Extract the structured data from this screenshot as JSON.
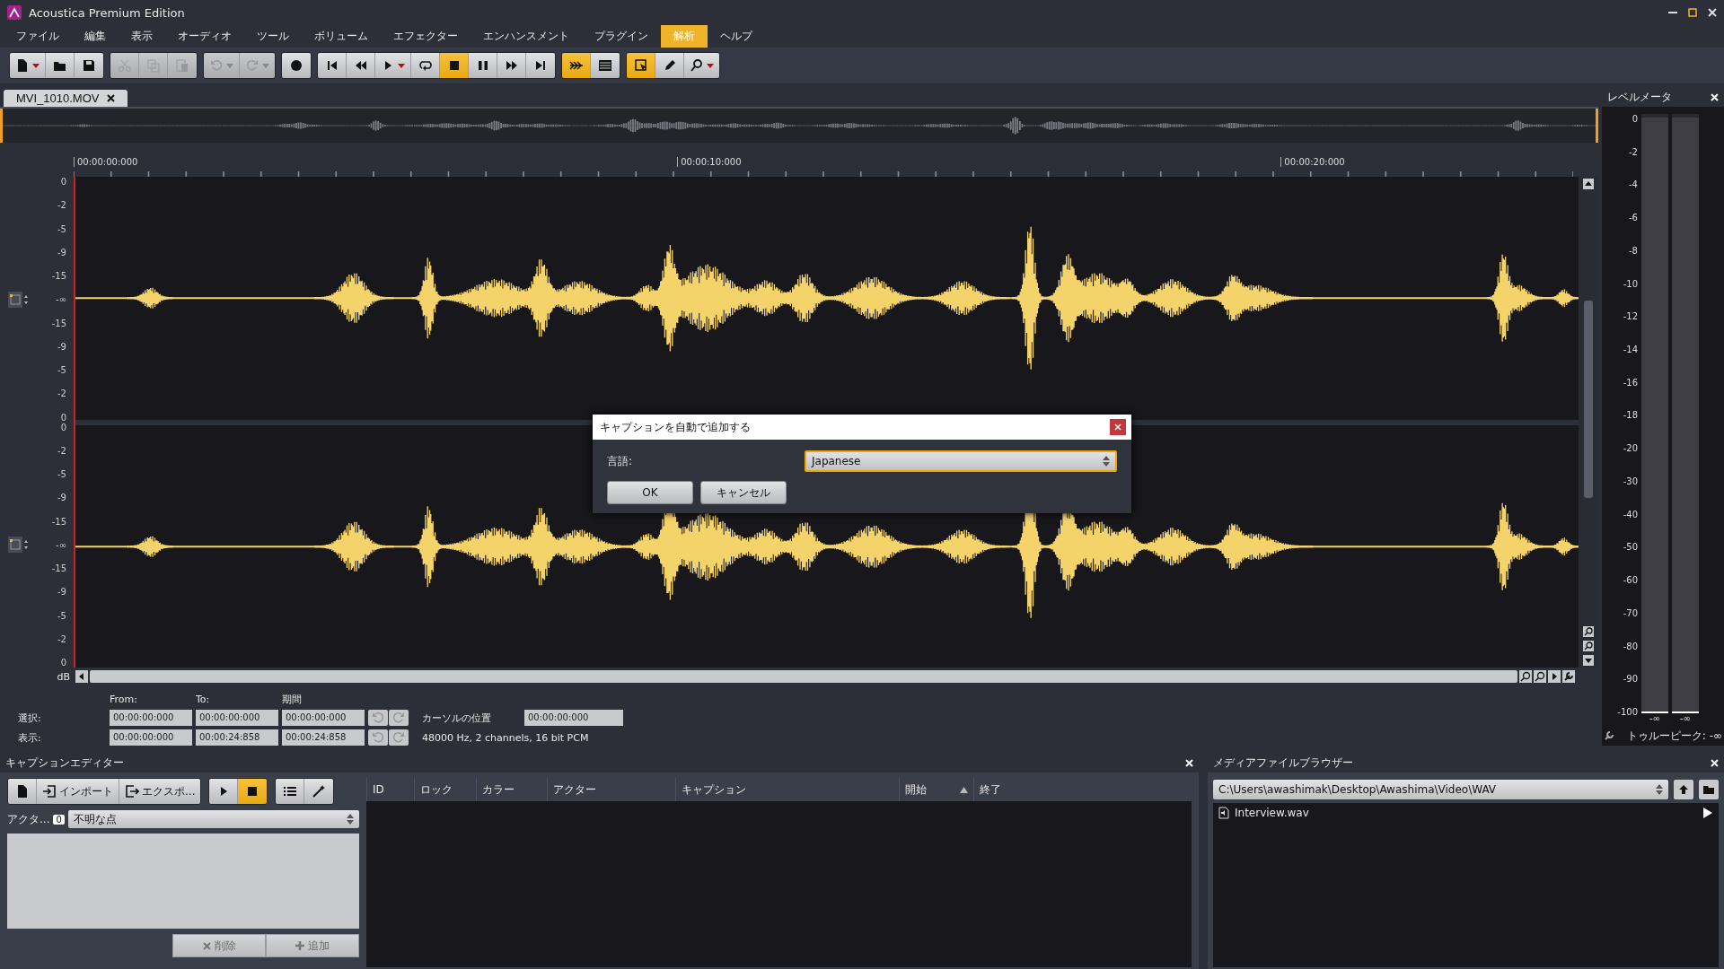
{
  "window": {
    "title": "Acoustica Premium Edition"
  },
  "menu": [
    {
      "label": "ファイル",
      "selected": false
    },
    {
      "label": "編集",
      "selected": false
    },
    {
      "label": "表示",
      "selected": false
    },
    {
      "label": "オーディオ",
      "selected": false
    },
    {
      "label": "ツール",
      "selected": false
    },
    {
      "label": "ボリューム",
      "selected": false
    },
    {
      "label": "エフェクター",
      "selected": false
    },
    {
      "label": "エンハンスメント",
      "selected": false
    },
    {
      "label": "プラグイン",
      "selected": false
    },
    {
      "label": "解析",
      "selected": true
    },
    {
      "label": "ヘルプ",
      "selected": false
    }
  ],
  "toolbar": [
    [
      {
        "kind": "new",
        "on": false,
        "disabled": false
      },
      {
        "kind": "open",
        "on": false,
        "disabled": false
      },
      {
        "kind": "save",
        "on": false,
        "disabled": false
      }
    ],
    [
      {
        "kind": "cut",
        "on": false,
        "disabled": true
      },
      {
        "kind": "copy",
        "on": false,
        "disabled": true
      },
      {
        "kind": "paste",
        "on": false,
        "disabled": true
      }
    ],
    [
      {
        "kind": "undo",
        "on": false,
        "disabled": true
      },
      {
        "kind": "redo",
        "on": false,
        "disabled": true
      }
    ],
    [
      {
        "kind": "record",
        "on": false,
        "disabled": false
      }
    ],
    [
      {
        "kind": "start",
        "on": false,
        "disabled": false
      },
      {
        "kind": "rewind",
        "on": false,
        "disabled": false
      },
      {
        "kind": "play",
        "on": false,
        "disabled": false
      },
      {
        "kind": "loop",
        "on": false,
        "disabled": false
      },
      {
        "kind": "stop",
        "on": true,
        "disabled": false
      },
      {
        "kind": "pause",
        "on": false,
        "disabled": false
      },
      {
        "kind": "forward",
        "on": false,
        "disabled": false
      },
      {
        "kind": "end",
        "on": false,
        "disabled": false
      }
    ],
    [
      {
        "kind": "follow",
        "on": true,
        "disabled": false
      },
      {
        "kind": "spectrum",
        "on": false,
        "disabled": false
      }
    ],
    [
      {
        "kind": "select",
        "on": true,
        "disabled": false
      },
      {
        "kind": "pencil",
        "on": false,
        "disabled": false
      },
      {
        "kind": "zoom",
        "on": false,
        "disabled": false
      }
    ]
  ],
  "file_tab": {
    "label": "MVI_1010.MOV",
    "selected": true
  },
  "ruler": [
    "00:00:00:000",
    "00:00:10:000",
    "00:00:20:000"
  ],
  "tracks": [
    {
      "scale": [
        "0",
        "-2",
        "-5",
        "-9",
        "-15",
        "-∞",
        "-15",
        "-9",
        "-5",
        "-2",
        "0"
      ]
    },
    {
      "scale": [
        "0",
        "-2",
        "-5",
        "-9",
        "-15",
        "-∞",
        "-15",
        "-9",
        "-5",
        "-2",
        "0"
      ]
    }
  ],
  "db_label": "dB",
  "selection": {
    "headers": [
      "From:",
      "To:",
      "期間"
    ],
    "rows": [
      {
        "label": "選択:",
        "values": [
          "00:00:00:000",
          "00:00:00:000",
          "00:00:00:000"
        ]
      },
      {
        "label": "表示:",
        "values": [
          "00:00:00:000",
          "00:00:24:858",
          "00:00:24:858"
        ]
      }
    ],
    "cursor_label": "カーソルの位置",
    "cursor_value": "00:00:00:000",
    "format": "48000 Hz, 2 channels, 16 bit PCM"
  },
  "level_meter": {
    "title": "レベルメータ",
    "scale": [
      "0",
      "-2",
      "-4",
      "-6",
      "-8",
      "-10",
      "-12",
      "-14",
      "-16",
      "-18",
      "-20",
      "-30",
      "-40",
      "-50",
      "-60",
      "-70",
      "-80",
      "-90",
      "-100"
    ],
    "channels": [
      {
        "level": 0,
        "reading": "-∞"
      },
      {
        "level": 0,
        "reading": "-∞"
      }
    ],
    "true_peak": "トゥルーピーク: -∞"
  },
  "caption_editor": {
    "title": "キャプションエディター",
    "buttons": [
      [
        {
          "kind": "new",
          "on": false
        },
        {
          "kind": "import",
          "label": "インポート",
          "on": false
        },
        {
          "kind": "export",
          "label": "エクスポ...",
          "on": false
        }
      ],
      [
        {
          "kind": "play",
          "on": false
        },
        {
          "kind": "stop",
          "on": true
        }
      ],
      [
        {
          "kind": "list",
          "on": false
        },
        {
          "kind": "wand",
          "on": false
        }
      ]
    ],
    "actor_label": "アクタ...",
    "actor_index": "0",
    "actor": "不明な点",
    "delete": "削除",
    "add": "追加",
    "columns": [
      {
        "label": "ID",
        "sorted": false
      },
      {
        "label": "ロック",
        "sorted": false
      },
      {
        "label": "カラー",
        "sorted": false
      },
      {
        "label": "アクター",
        "sorted": false
      },
      {
        "label": "キャプション",
        "sorted": false
      },
      {
        "label": "開始",
        "sorted": true
      },
      {
        "label": "終了",
        "sorted": false
      }
    ]
  },
  "media_browser": {
    "title": "メディアファイルブラウザー",
    "path": "C:\\Users\\awashimak\\Desktop\\Awashima\\Video\\WAV",
    "files": [
      "Interview.wav"
    ]
  },
  "dialog": {
    "title": "キャプションを自動で追加する",
    "label": "言語:",
    "value": "Japanese",
    "ok": "OK",
    "cancel": "キャンセル"
  }
}
